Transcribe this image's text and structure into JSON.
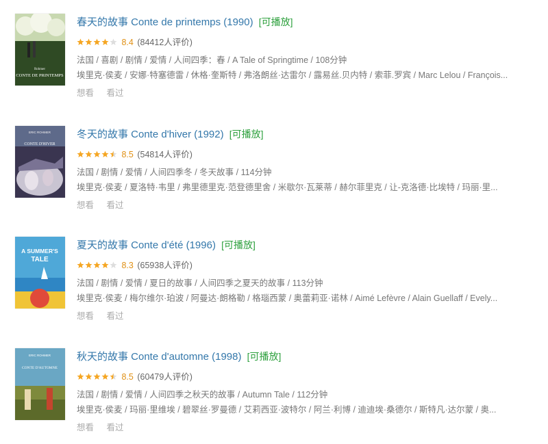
{
  "items": [
    {
      "title": "春天的故事 Conte de printemps (1990)",
      "playable": "[可播放]",
      "rating": 8.4,
      "rating_text": "8.4",
      "stars": 4,
      "votes": "(84412人评价)",
      "info": "法国 / 喜剧 / 剧情 / 爱情 / 人间四季：春 / A Tale of Springtime / 108分钟",
      "cast": "埃里克·侯麦 / 安娜·特塞德雷 / 休格·奎斯特 / 弗洛朗丝·达雷尔 / 露易丝.贝内特 / 索菲.罗宾 / Marc Lelou / François...",
      "want": "想看",
      "seen": "看过",
      "poster_text": [
        "Rohmer",
        "CONTE DE PRINTEMPS"
      ]
    },
    {
      "title": "冬天的故事 Conte d'hiver (1992)",
      "playable": "[可播放]",
      "rating": 8.5,
      "rating_text": "8.5",
      "stars": 4.5,
      "votes": "(54814人评价)",
      "info": "法国 / 剧情 / 爱情 / 人间四季冬 / 冬天故事 / 114分钟",
      "cast": "埃里克·侯麦 / 夏洛特·韦里 / 弗里德里克·范登德里舍 / 米歇尔·瓦莱蒂 / 赫尔菲里克 / 让-克洛德·比埃特 / 玛丽·里...",
      "want": "想看",
      "seen": "看过",
      "poster_text": [
        "ERIC ROHMER",
        "CONTE D'HIVER"
      ]
    },
    {
      "title": "夏天的故事 Conte d'été (1996)",
      "playable": "[可播放]",
      "rating": 8.3,
      "rating_text": "8.3",
      "stars": 4,
      "votes": "(65938人评价)",
      "info": "法国 / 剧情 / 爱情 / 夏日的故事 / 人间四季之夏天的故事 / 113分钟",
      "cast": "埃里克·侯麦 / 梅尔维尔·珀波 / 阿曼达·朗格勒 / 格瑙西蒙 / 奥蕾莉亚·诺林 / Aimé Lefèvre / Alain Guellaff / Evely...",
      "want": "想看",
      "seen": "看过",
      "poster_text": [
        "A SUMMER'S",
        "TALE"
      ]
    },
    {
      "title": "秋天的故事 Conte d'automne (1998)",
      "playable": "[可播放]",
      "rating": 8.5,
      "rating_text": "8.5",
      "stars": 4.5,
      "votes": "(60479人评价)",
      "info": "法国 / 剧情 / 爱情 / 人间四季之秋天的故事 / Autumn Tale / 112分钟",
      "cast": "埃里克·侯麦 / 玛丽·里维埃 / 碧翠丝·罗曼德 / 艾莉西亚·波特尔 / 阿兰·利博 / 迪迪埃·桑德尔 / 斯特凡·达尔蒙 / 奥...",
      "want": "想看",
      "seen": "看过",
      "poster_text": [
        "ERIC ROHMER",
        "CONTE D'AUTOMNE"
      ]
    }
  ],
  "colors": {
    "title": "#3377aa",
    "playable": "#2b9f3b",
    "star": "#f5a623",
    "star_empty": "#dddddd",
    "meta": "#777777",
    "actions": "#aaaaaa"
  }
}
